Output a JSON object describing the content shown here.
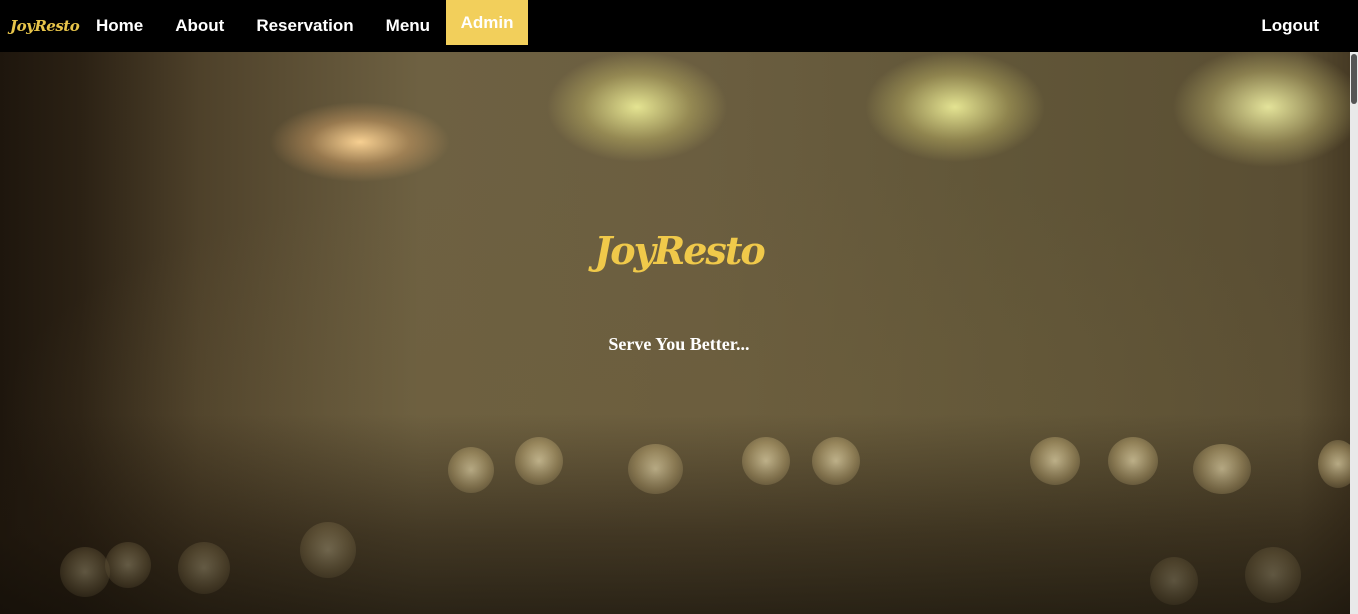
{
  "navbar": {
    "brand": "JoyResto",
    "links": [
      {
        "label": "Home"
      },
      {
        "label": "About"
      },
      {
        "label": "Reservation"
      },
      {
        "label": "Menu"
      },
      {
        "label": "Admin",
        "active": true
      }
    ],
    "logout": "Logout"
  },
  "hero": {
    "logo": "JoyResto",
    "tagline": "Serve You Better..."
  },
  "colors": {
    "accent": "#f2cf5b",
    "navbar_bg": "#000000",
    "logo_gold": "#f0c94a"
  }
}
